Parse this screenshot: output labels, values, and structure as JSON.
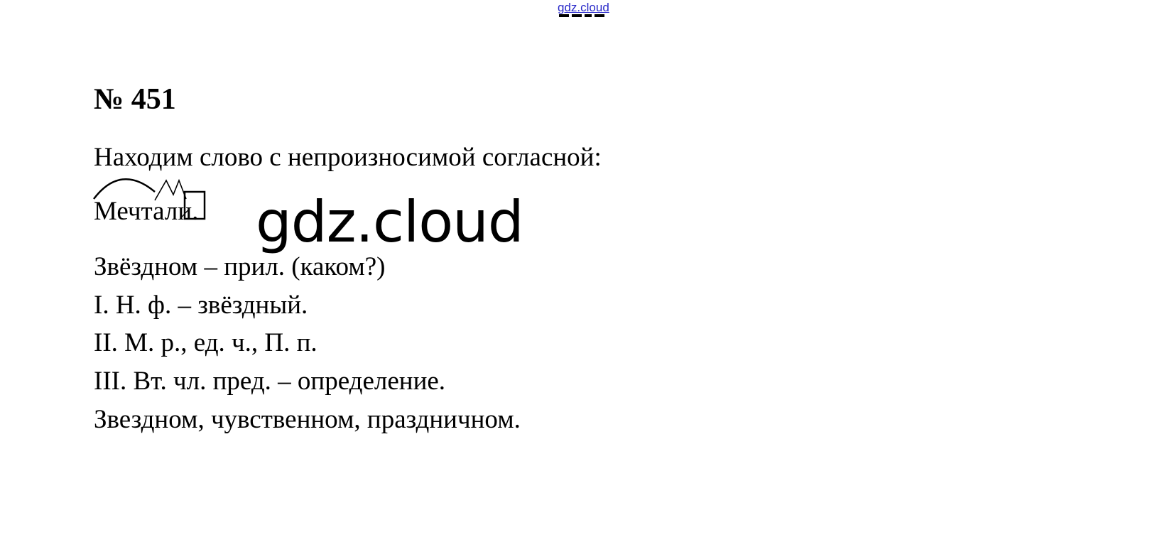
{
  "header": {
    "site_link": "gdz.cloud"
  },
  "task": {
    "number": "№ 451",
    "intro": "Находим слово с непроизносимой согласной:",
    "word": "Мечтали.",
    "lines": [
      "Звёздном – прил. (каком?)",
      "I. Н. ф. – звёздный.",
      "II. М. р., ед. ч., П. п.",
      "III. Вт. чл. пред. – определение.",
      "Звездном, чувственном, праздничном."
    ]
  },
  "watermark": {
    "text": "gdz.cloud"
  },
  "colors": {
    "text": "#000000",
    "link": "#2929c9",
    "background": "#ffffff"
  }
}
